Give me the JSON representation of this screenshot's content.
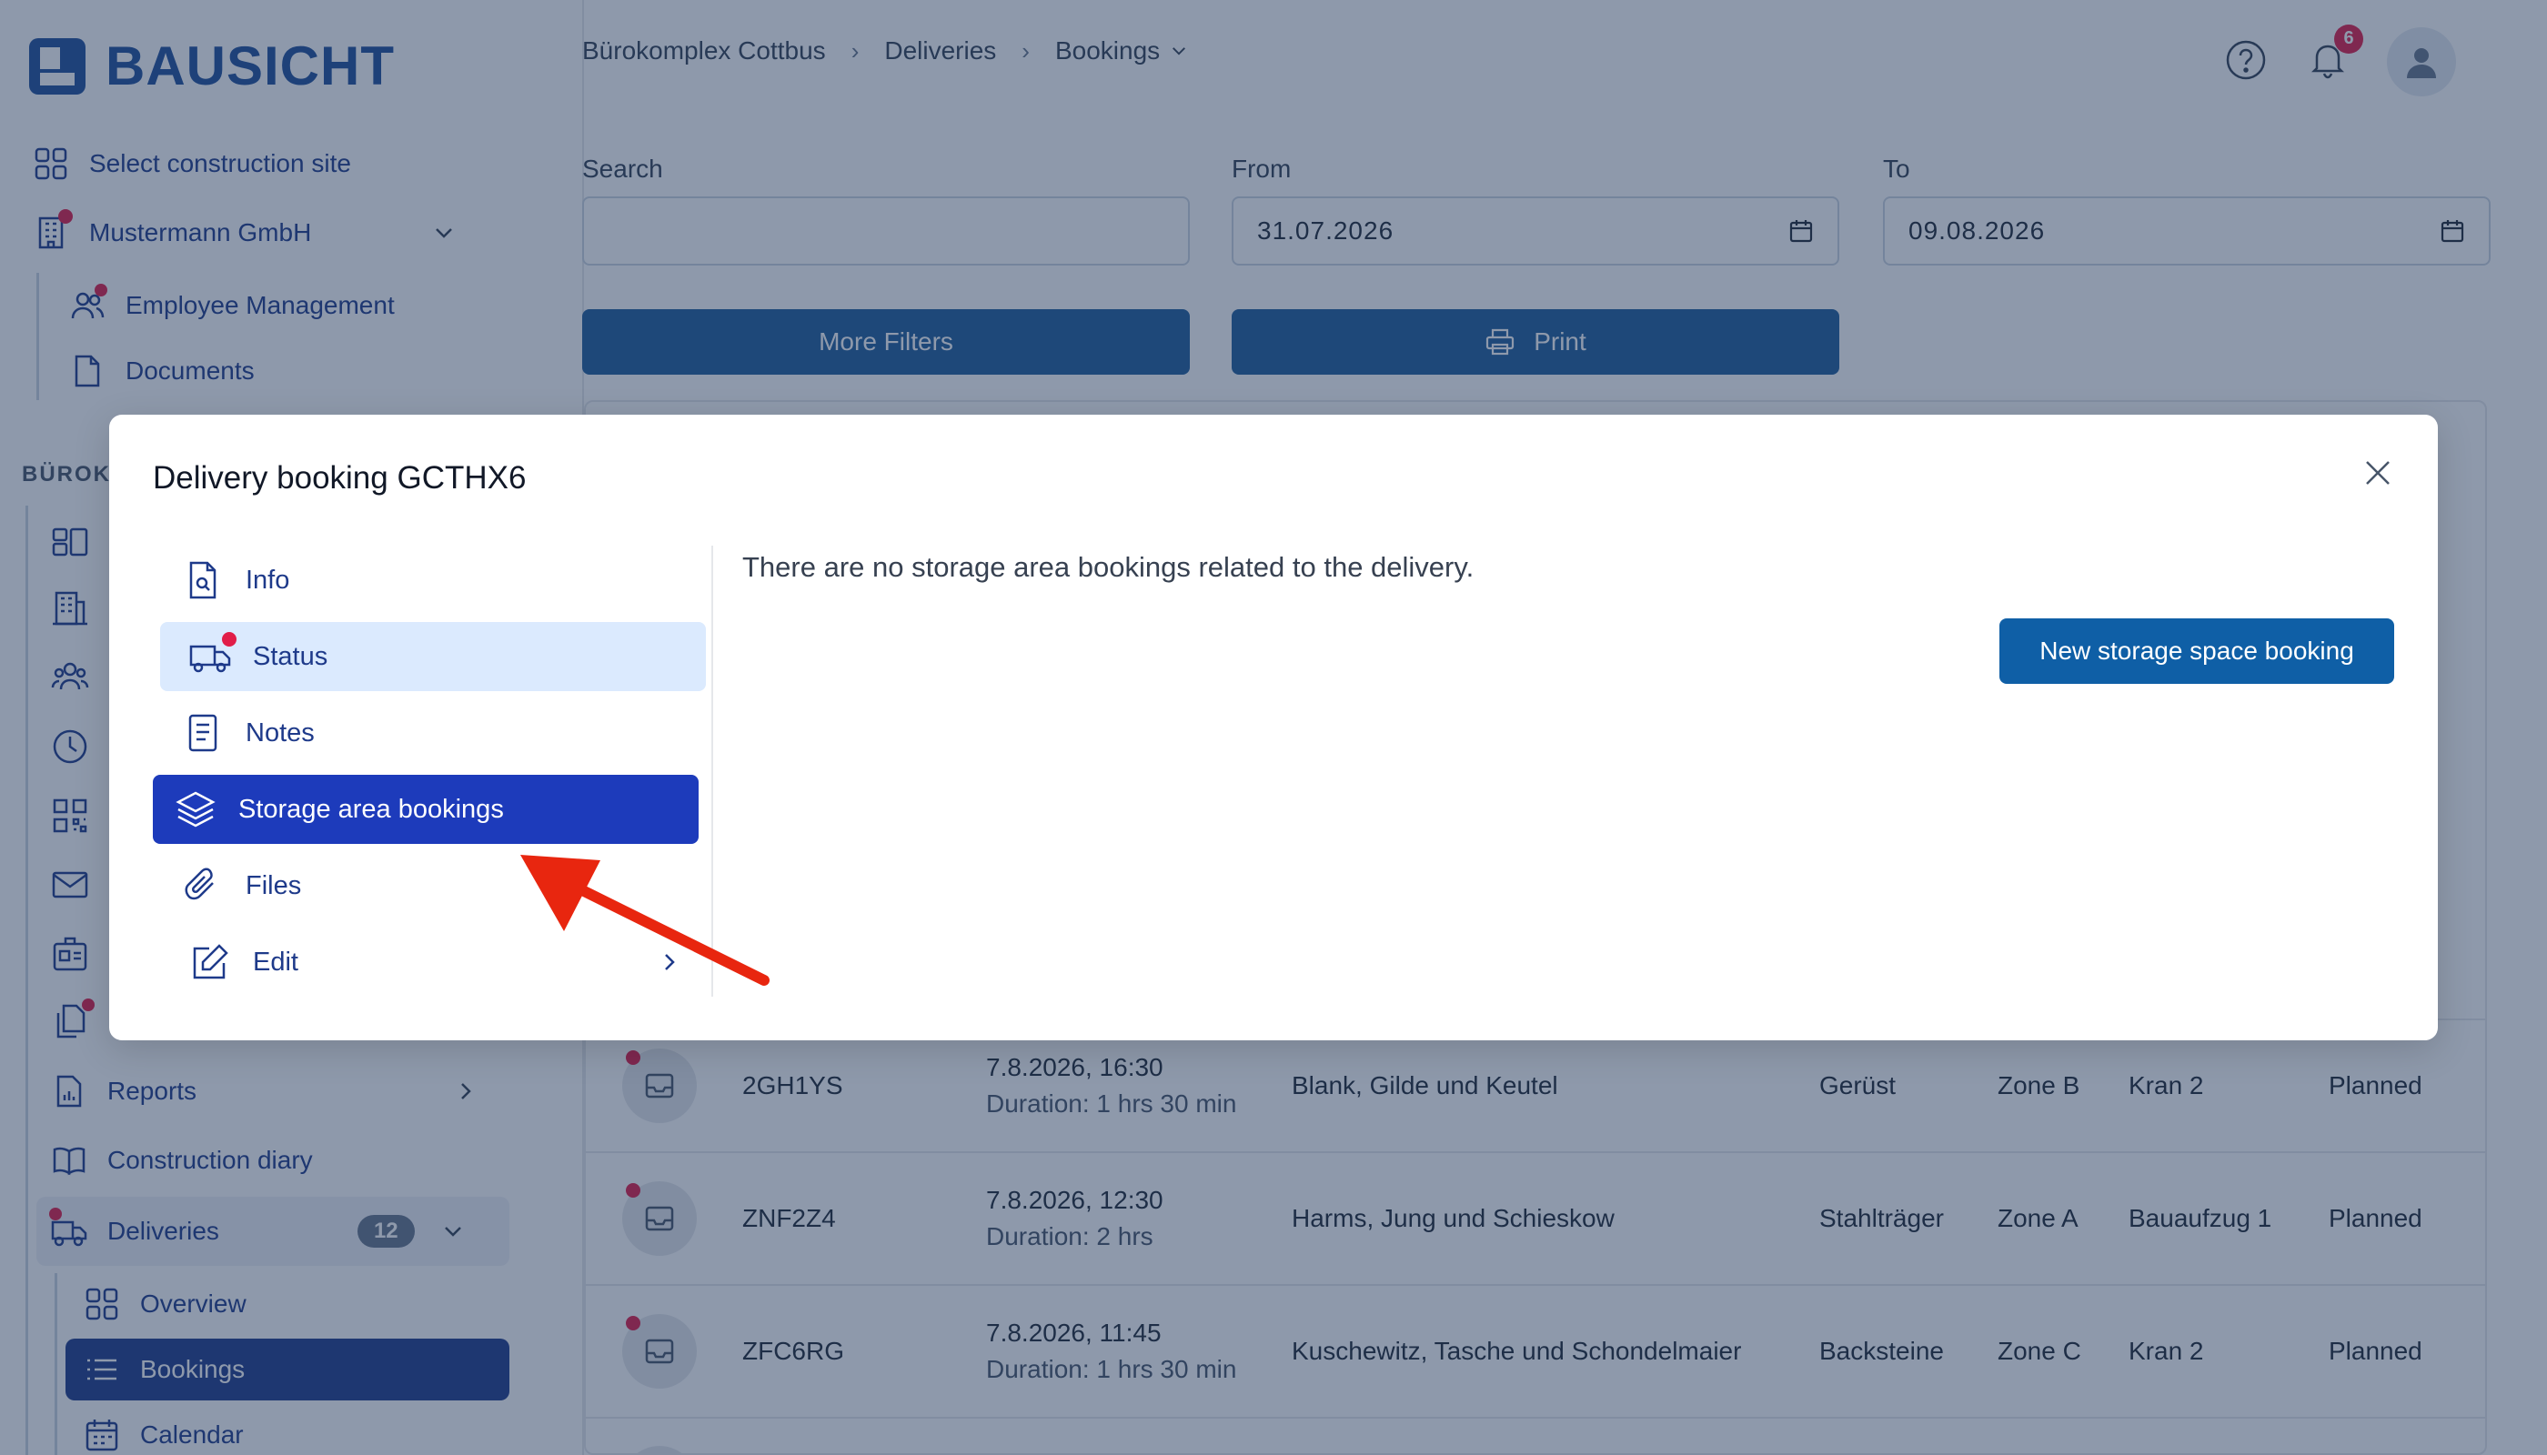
{
  "brand": {
    "name": "BAUSICHT"
  },
  "sidebar": {
    "select_site": "Select construction site",
    "company": "Mustermann GmbH",
    "company_items": [
      "Employee Management",
      "Documents"
    ],
    "section": "BÜROKO",
    "reports": "Reports",
    "diary": "Construction diary",
    "deliveries": "Deliveries",
    "deliveries_count": "12",
    "delivery_items": [
      "Overview",
      "Bookings",
      "Calendar"
    ]
  },
  "breadcrumb": [
    "Bürokomplex Cottbus",
    "Deliveries",
    "Bookings"
  ],
  "notifications": {
    "count": "6"
  },
  "filters": {
    "search_label": "Search",
    "search_value": "",
    "from_label": "From",
    "from_value": "31.07.2026",
    "to_label": "To",
    "to_value": "09.08.2026",
    "more_filters": "More Filters",
    "print": "Print"
  },
  "table": {
    "rows": [
      {
        "id": "2GH1YS",
        "date": "7.8.2026, 16:30",
        "duration": "Duration: 1 hrs 30 min",
        "company": "Blank, Gilde und Keutel",
        "material": "Gerüst",
        "zone": "Zone B",
        "equipment": "Kran 2",
        "status": "Planned"
      },
      {
        "id": "ZNF2Z4",
        "date": "7.8.2026, 12:30",
        "duration": "Duration: 2 hrs",
        "company": "Harms, Jung und Schieskow",
        "material": "Stahlträger",
        "zone": "Zone A",
        "equipment": "Bauaufzug 1",
        "status": "Planned"
      },
      {
        "id": "ZFC6RG",
        "date": "7.8.2026, 11:45",
        "duration": "Duration: 1 hrs 30 min",
        "company": "Kuschewitz, Tasche und Schondelmaier",
        "material": "Backsteine",
        "zone": "Zone C",
        "equipment": "Kran 2",
        "status": "Planned"
      }
    ]
  },
  "modal": {
    "title": "Delivery booking GCTHX6",
    "nav": {
      "info": "Info",
      "status": "Status",
      "notes": "Notes",
      "storage": "Storage area bookings",
      "files": "Files",
      "edit": "Edit"
    },
    "empty_message": "There are no storage area bookings related to the delivery.",
    "new_button": "New storage space booking"
  },
  "colors": {
    "brand": "#1e4e9a",
    "active_nav": "#1d3bbb",
    "status_highlight": "#dbeafe",
    "primary_button": "#0f5fa6",
    "notification": "#e11d48",
    "annotation_arrow": "#e8260f"
  }
}
